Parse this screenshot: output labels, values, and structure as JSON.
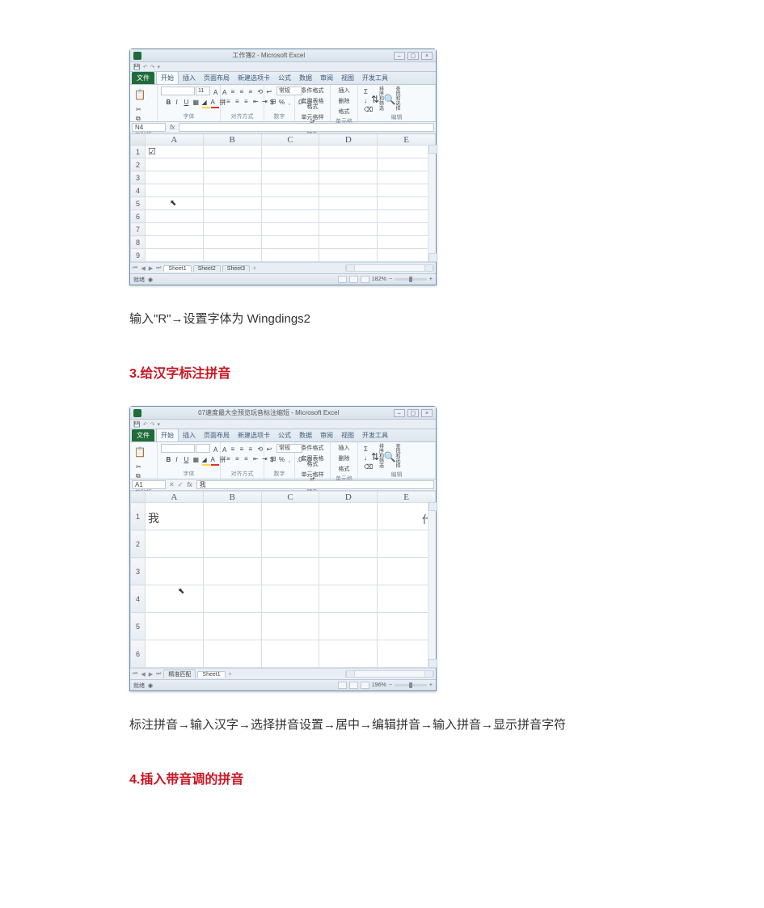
{
  "excel1": {
    "title": "工作簿2 - Microsoft Excel",
    "file_tab": "文件",
    "tabs": [
      "开始",
      "插入",
      "页面布局",
      "新建选项卡",
      "公式",
      "数据",
      "审阅",
      "视图",
      "开发工具"
    ],
    "ribbon": {
      "clipboard": {
        "paste": "粘贴",
        "label": "剪贴板"
      },
      "font": {
        "name": "",
        "size": "11",
        "label": "字体"
      },
      "align": {
        "label": "对齐方式"
      },
      "number": {
        "label": "数字"
      },
      "style": {
        "cond": "条件格式",
        "table": "套用表格格式",
        "cell": "单元格样式",
        "label": "样式"
      },
      "cells": {
        "ins": "插入",
        "del": "删除",
        "fmt": "格式",
        "label": "单元格"
      },
      "edit": {
        "sort": "排序和筛选",
        "find": "查找和选择",
        "label": "编辑"
      }
    },
    "namebox": "N4",
    "formula": "",
    "columns": [
      "A",
      "B",
      "C",
      "D",
      "E"
    ],
    "rows": [
      "1",
      "2",
      "3",
      "4",
      "5",
      "6",
      "7",
      "8",
      "9"
    ],
    "cell_a1": "☑",
    "sheets": [
      "Sheet1",
      "Sheet2",
      "Sheet3"
    ],
    "status_left": "就绪",
    "zoom": "182%"
  },
  "para1": "输入\"R\"→设置字体为 Wingdings2",
  "heading3": "3.给汉字标注拼音",
  "excel2": {
    "title": "07速度最大全预览玩音标注缩短 - Microsoft Excel",
    "file_tab": "文件",
    "tabs": [
      "开始",
      "插入",
      "页面布局",
      "新建选项卡",
      "公式",
      "数据",
      "审阅",
      "视图",
      "开发工具"
    ],
    "ribbon": {
      "clipboard": {
        "paste": "粘贴",
        "label": "剪贴板"
      },
      "font": {
        "name": "",
        "size": "",
        "label": "字体"
      },
      "align": {
        "label": "对齐方式"
      },
      "number": {
        "label": "数字"
      },
      "style": {
        "cond": "条件格式",
        "table": "套用表格格式",
        "cell": "单元格样式",
        "label": "样式"
      },
      "cells": {
        "ins": "插入",
        "del": "删除",
        "fmt": "格式",
        "label": "单元格"
      },
      "edit": {
        "sort": "排序和筛选",
        "find": "查找和选择",
        "label": "编辑"
      }
    },
    "namebox": "A1",
    "formula": "我",
    "columns": [
      "A",
      "B",
      "C",
      "D",
      "E"
    ],
    "rows": [
      "1",
      "2",
      "3",
      "4",
      "5",
      "6"
    ],
    "cell_a1": "我",
    "cell_e1_partial": "什",
    "sheets_prefix": "精准匹配",
    "sheets": [
      "Sheet1"
    ],
    "status_left": "就绪",
    "zoom": "196%"
  },
  "para2": "标注拼音→输入汉字→选择拼音设置→居中→编辑拼音→输入拼音→显示拼音字符",
  "heading4": "4.插入带音调的拼音"
}
